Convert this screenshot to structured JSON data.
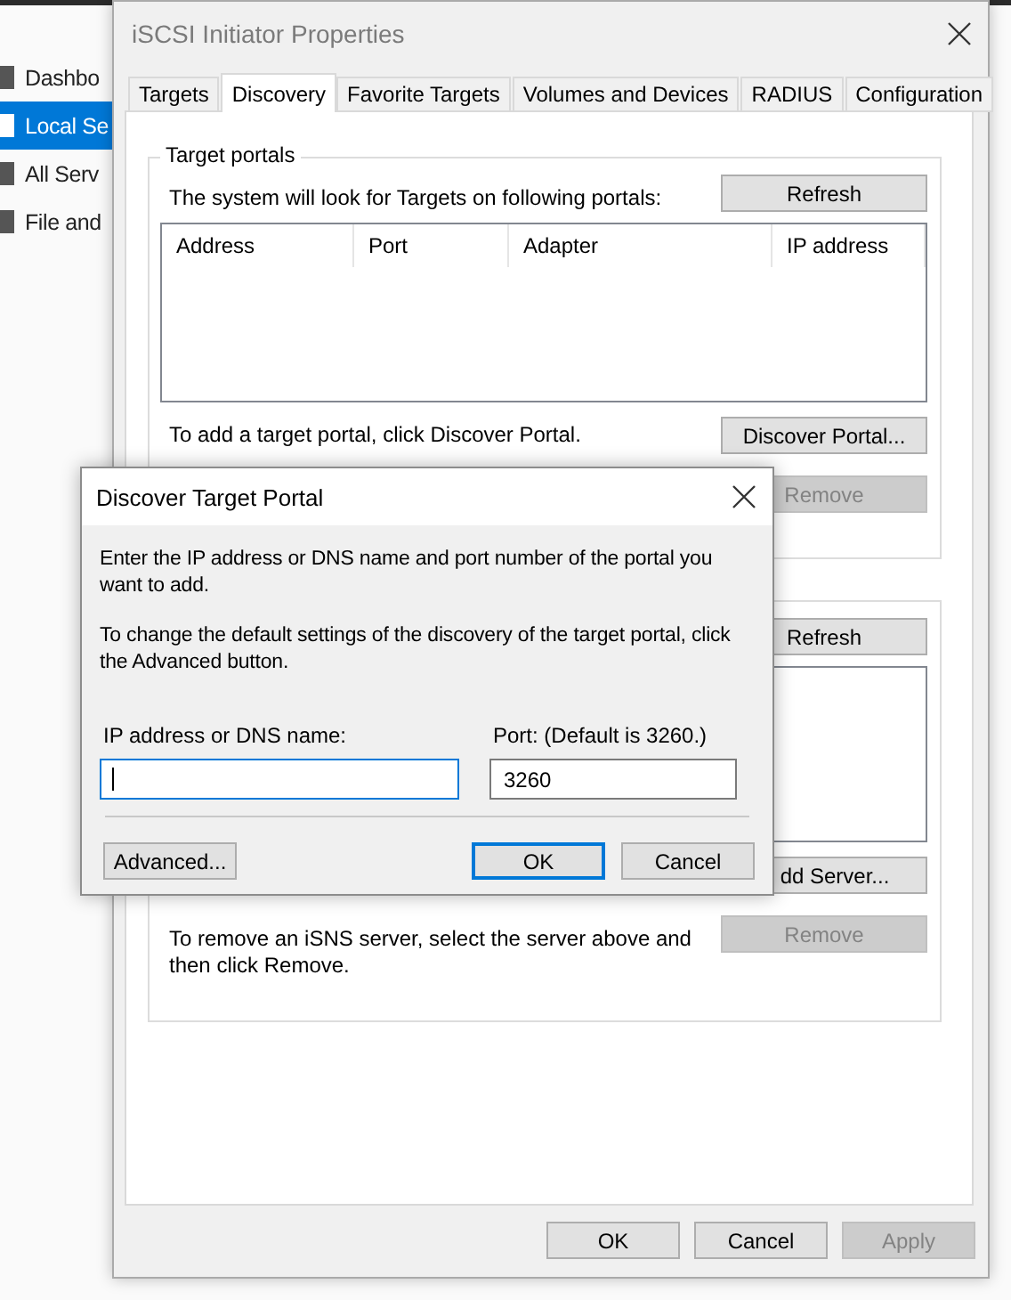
{
  "sidebar": {
    "items": [
      {
        "label": "Dashbo",
        "selected": false
      },
      {
        "label": "Local Se",
        "selected": true
      },
      {
        "label": "All Serv",
        "selected": false
      },
      {
        "label": "File and",
        "selected": false
      }
    ]
  },
  "properties_window": {
    "title": "iSCSI Initiator Properties",
    "active": false,
    "tabs": [
      {
        "label": "Targets",
        "selected": false
      },
      {
        "label": "Discovery",
        "selected": true
      },
      {
        "label": "Favorite Targets",
        "selected": false
      },
      {
        "label": "Volumes and Devices",
        "selected": false
      },
      {
        "label": "RADIUS",
        "selected": false
      },
      {
        "label": "Configuration",
        "selected": false
      }
    ],
    "target_portals": {
      "legend": "Target portals",
      "refresh": {
        "label": "Refresh",
        "disabled": false
      },
      "hint": "The system will look for Targets on following portals:",
      "columns": [
        "Address",
        "Port",
        "Adapter",
        "IP address"
      ],
      "add_hint": "To add a target portal, click Discover Portal.",
      "discover": {
        "label": "Discover Portal...",
        "disabled": false
      },
      "remove": {
        "label": "Remove",
        "disabled": true
      }
    },
    "isns_servers": {
      "refresh": {
        "label": "Refresh",
        "disabled": false
      },
      "add": {
        "label": "dd Server...",
        "disabled": false
      },
      "remove_hint": "To remove an iSNS server, select the server above and then click Remove.",
      "remove": {
        "label": "Remove",
        "disabled": true
      }
    },
    "buttons": [
      {
        "label": "OK",
        "disabled": false
      },
      {
        "label": "Cancel",
        "disabled": false
      },
      {
        "label": "Apply",
        "disabled": true
      }
    ]
  },
  "dialog": {
    "title": "Discover Target Portal",
    "intro": "Enter the IP address or DNS name and port number of the portal you want to add.",
    "advanced_hint": "To change the default settings of the discovery of the target portal, click the Advanced button.",
    "ip_field": {
      "label": "IP address or DNS name:",
      "focused": true
    },
    "port_field": {
      "label": "Port: (Default is 3260.)",
      "value": "3260",
      "focused": false
    },
    "buttons": [
      {
        "label": "Advanced...",
        "default": false
      },
      {
        "label": "OK",
        "default": true
      },
      {
        "label": "Cancel",
        "default": false
      }
    ]
  }
}
